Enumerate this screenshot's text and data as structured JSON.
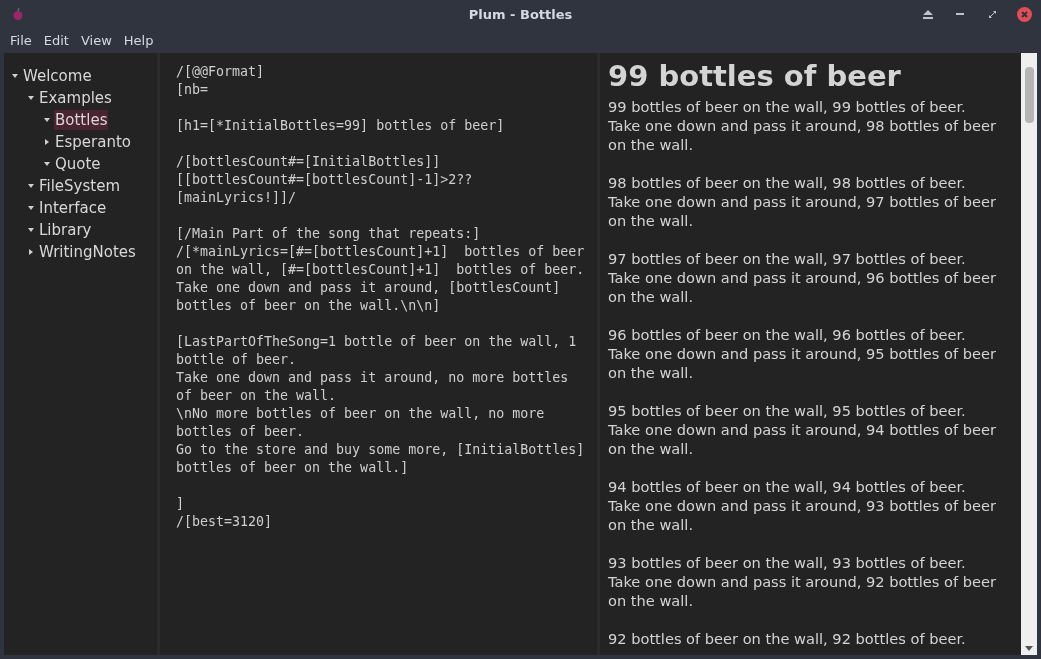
{
  "window": {
    "title": "Plum - Bottles"
  },
  "menu": [
    "File",
    "Edit",
    "View",
    "Help"
  ],
  "tree": [
    {
      "label": "Welcome",
      "expanded": true,
      "selected": false,
      "children": [
        {
          "label": "Examples",
          "expanded": true,
          "selected": false,
          "children": [
            {
              "label": "Bottles",
              "expanded": true,
              "selected": true
            },
            {
              "label": "Esperanto",
              "expanded": false,
              "selected": false
            },
            {
              "label": "Quote",
              "expanded": true,
              "selected": false
            }
          ]
        },
        {
          "label": "FileSystem",
          "expanded": true,
          "selected": false
        },
        {
          "label": "Interface",
          "expanded": true,
          "selected": false
        },
        {
          "label": "Library",
          "expanded": true,
          "selected": false
        },
        {
          "label": "WritingNotes",
          "expanded": false,
          "selected": false
        }
      ]
    }
  ],
  "editor": {
    "blocks": [
      [
        "/[@@Format]",
        "[nb="
      ],
      [
        "[h1=[*InitialBottles=99] bottles of beer]"
      ],
      [
        "/[bottlesCount#=[InitialBottles]]",
        "[[bottlesCount#=[bottlesCount]-1]>2??",
        "[mainLyrics!]]/"
      ],
      [
        "[/Main Part of the song that repeats:]",
        "/[*mainLyrics=[#=[bottlesCount]+1]  bottles of beer",
        "on the wall, [#=[bottlesCount]+1]  bottles of beer.",
        "Take one down and pass it around, [bottlesCount]",
        "bottles of beer on the wall.\\n\\n]"
      ],
      [
        "[LastPartOfTheSong=1 bottle of beer on the wall, 1",
        "bottle of beer.",
        "Take one down and pass it around, no more bottles",
        "of beer on the wall.",
        "\\nNo more bottles of beer on the wall, no more",
        "bottles of beer.",
        "Go to the store and buy some more, [InitialBottles]",
        "bottles of beer on the wall.]"
      ],
      [
        "]",
        "/[best=3120]"
      ]
    ]
  },
  "preview": {
    "heading": "99 bottles of beer",
    "verses": [
      "99 bottles of beer on the wall, 99 bottles of beer.\nTake one down and pass it around, 98 bottles of beer on the wall.",
      "98 bottles of beer on the wall, 98 bottles of beer.\nTake one down and pass it around, 97 bottles of beer on the wall.",
      "97 bottles of beer on the wall, 97 bottles of beer.\nTake one down and pass it around, 96 bottles of beer on the wall.",
      "96 bottles of beer on the wall, 96 bottles of beer.\nTake one down and pass it around, 95 bottles of beer on the wall.",
      "95 bottles of beer on the wall, 95 bottles of beer.\nTake one down and pass it around, 94 bottles of beer on the wall.",
      "94 bottles of beer on the wall, 94 bottles of beer.\nTake one down and pass it around, 93 bottles of beer on the wall.",
      "93 bottles of beer on the wall, 93 bottles of beer.\nTake one down and pass it around, 92 bottles of beer on the wall.",
      "92 bottles of beer on the wall, 92 bottles of beer."
    ]
  }
}
